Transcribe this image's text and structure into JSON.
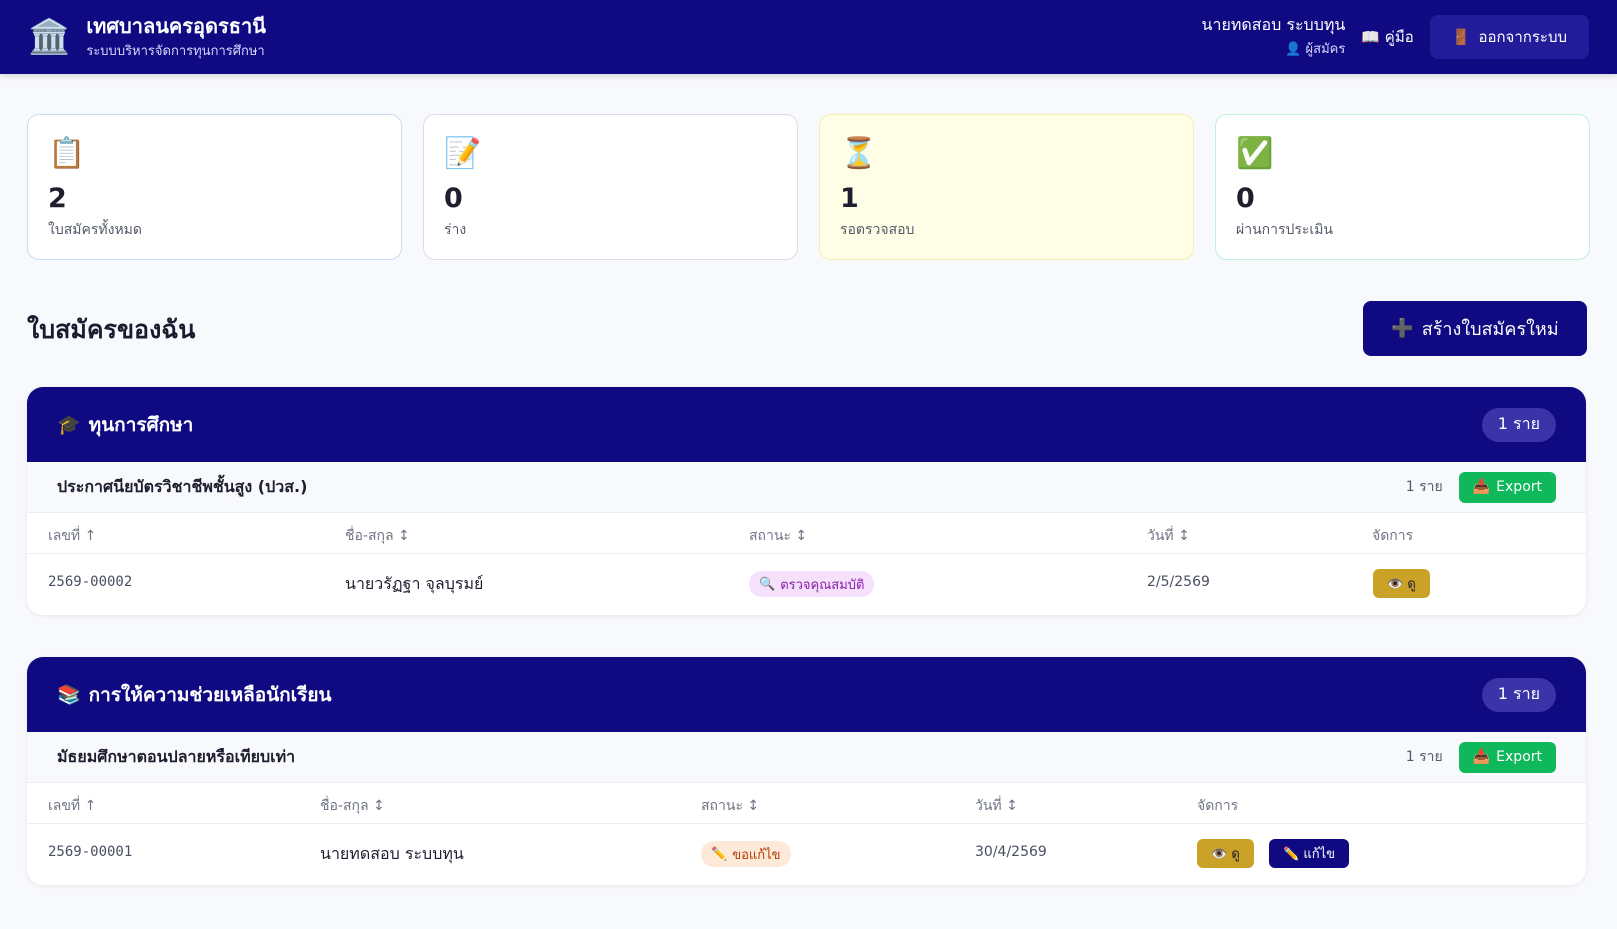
{
  "header": {
    "brand_icon": "🏛️",
    "title": "เทศบาลนครอุดรธานี",
    "subtitle": "ระบบบริหารจัดการทุนการศึกษา",
    "user_name": "นายทดสอบ ระบบทุน",
    "user_role": "👤 ผู้สมัคร",
    "manual_label": "📖 คู่มือ",
    "logout_icon": "🚪",
    "logout_label": "ออกจากระบบ"
  },
  "stats": [
    {
      "icon": "📋",
      "value": "2",
      "label": "ใบสมัครทั้งหมด"
    },
    {
      "icon": "📝",
      "value": "0",
      "label": "ร่าง"
    },
    {
      "icon": "⏳",
      "value": "1",
      "label": "รอตรวจสอบ"
    },
    {
      "icon": "✅",
      "value": "0",
      "label": "ผ่านการประเมิน"
    }
  ],
  "section": {
    "title": "ใบสมัครของฉัน",
    "new_button_icon": "➕",
    "new_button_label": "สร้างใบสมัครใหม่"
  },
  "groups": [
    {
      "icon": "🎓",
      "title": "ทุนการศึกษา",
      "count": "1 ราย",
      "subgroup": {
        "title": "ประกาศนียบัตรวิชาชีพชั้นสูง (ปวส.)",
        "count": "1 ราย",
        "export_icon": "📥",
        "export_label": "Export"
      },
      "columns": [
        "เลขที่ ↑",
        "ชื่อ-สกุล ↕",
        "สถานะ ↕",
        "วันที่ ↕",
        "จัดการ"
      ],
      "rows": [
        {
          "id": "2569-00002",
          "name": "นายวรัฏฐา จุลบุรมย์",
          "status_icon": "🔍",
          "status": "ตรวจคุณสมบัติ",
          "date": "2/5/2569",
          "view_label": "👁️ ดู"
        }
      ]
    },
    {
      "icon": "📚",
      "title": "การให้ความช่วยเหลือนักเรียน",
      "count": "1 ราย",
      "subgroup": {
        "title": "มัธยมศึกษาตอนปลายหรือเทียบเท่า",
        "count": "1 ราย",
        "export_icon": "📥",
        "export_label": "Export"
      },
      "columns": [
        "เลขที่ ↑",
        "ชื่อ-สกุล ↕",
        "สถานะ ↕",
        "วันที่ ↕",
        "จัดการ"
      ],
      "rows": [
        {
          "id": "2569-00001",
          "name": "นายทดสอบ ระบบทุน",
          "status_icon": "✏️",
          "status": "ขอแก้ไข",
          "date": "30/4/2569",
          "view_label": "👁️ ดู",
          "edit_label": "✏️ แก้ไข"
        }
      ]
    }
  ],
  "colors": {
    "primary": "#0f0a82",
    "export": "#0fb85a",
    "view_button": "#c9a227",
    "pending_card": "#fefee6"
  }
}
